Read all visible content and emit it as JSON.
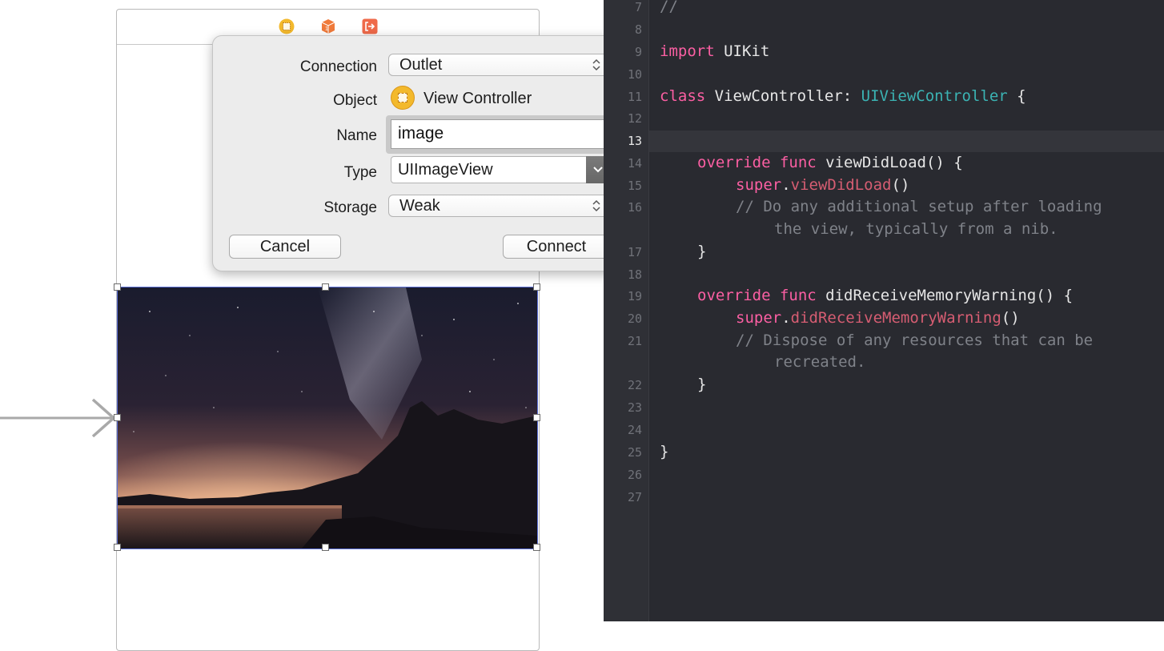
{
  "storyboard": {
    "dock_icons": [
      "view-controller-icon",
      "first-responder-icon",
      "exit-icon"
    ],
    "image_view": {
      "content": "night-sky-milky-way-lake-photo",
      "selected": true
    }
  },
  "popover": {
    "connection_label": "Connection",
    "connection_value": "Outlet",
    "object_label": "Object",
    "object_value": "View Controller",
    "name_label": "Name",
    "name_value": "image",
    "type_label": "Type",
    "type_value": "UIImageView",
    "storage_label": "Storage",
    "storage_value": "Weak",
    "cancel_label": "Cancel",
    "connect_label": "Connect"
  },
  "editor": {
    "current_line": "13",
    "colors": {
      "background": "#292a30",
      "keyword": "#fc5fa3",
      "type": "#3bb3b3",
      "comment": "#7f8289",
      "call": "#d65d72",
      "plain": "#e6e6e6"
    },
    "line_numbers": [
      "7",
      "8",
      "9",
      "10",
      "11",
      "12",
      "13",
      "14",
      "15",
      "16",
      "17",
      "18",
      "19",
      "20",
      "21",
      "22",
      "23",
      "24",
      "25",
      "26",
      "27"
    ],
    "code": {
      "l7": "//",
      "l9_kw": "import",
      "l9_rest": " UIKit",
      "l11_kw": "class",
      "l11_name": " ViewController: ",
      "l11_type": "UIViewController",
      "l11_brace": " {",
      "l14_kw": "override func",
      "l14_rest": " viewDidLoad() {",
      "l15_kw": "super",
      "l15_dot": ".",
      "l15_call": "viewDidLoad",
      "l15_paren": "()",
      "l16_a": "// Do any additional setup after loading",
      "l16_b": "the view, typically from a nib.",
      "l17": "}",
      "l19_kw": "override func",
      "l19_rest": " didReceiveMemoryWarning() {",
      "l20_kw": "super",
      "l20_dot": ".",
      "l20_call": "didReceiveMemoryWarning",
      "l20_paren": "()",
      "l21_a": "// Dispose of any resources that can be",
      "l21_b": "recreated.",
      "l22": "}",
      "l25": "}"
    }
  }
}
